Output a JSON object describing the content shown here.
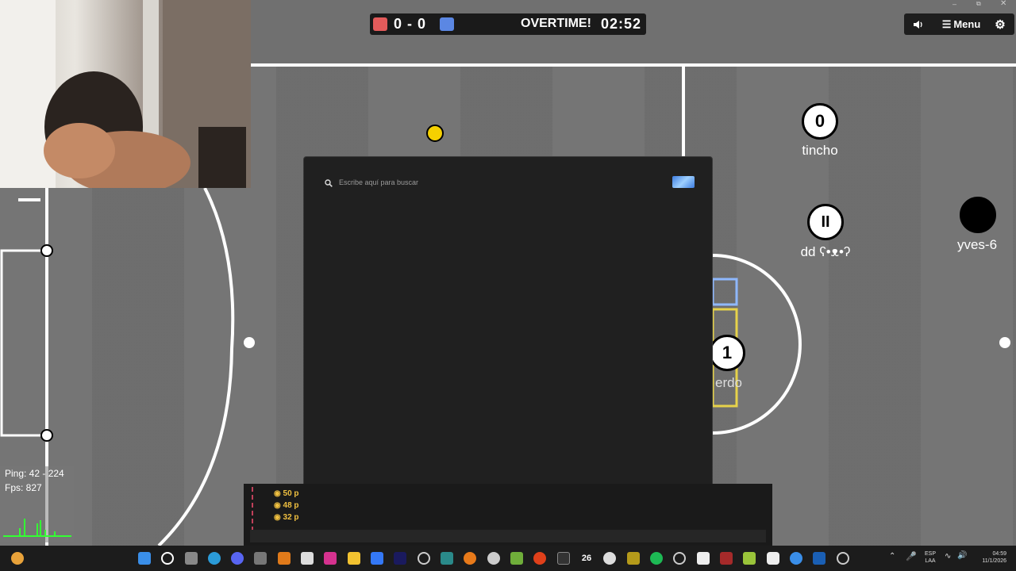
{
  "scoreboard": {
    "red_score": "0",
    "separator": "-",
    "blue_score": "0",
    "status": "OVERTIME!",
    "clock": "02:52",
    "red_color": "#e35b5b",
    "blue_color": "#5b87e3"
  },
  "topbar": {
    "sound_icon": "speaker-icon",
    "menu_label": "Menu",
    "settings_icon": "gear-icon"
  },
  "players": [
    {
      "label": "0",
      "name": "tincho"
    },
    {
      "label": "II",
      "name": "dd ʕ•ᴥ•ʔ"
    },
    {
      "label": "",
      "name": "yves-6"
    },
    {
      "label": "1",
      "name": "erdo"
    }
  ],
  "search": {
    "placeholder": "Escribe aquí para buscar"
  },
  "stats": {
    "ping": "Ping: 42 - 224",
    "fps": "Fps: 827"
  },
  "chat": {
    "items": [
      "50 p",
      "48 p",
      "32 p"
    ]
  },
  "taskbar": {
    "lang_1": "ESP",
    "lang_2": "LAA",
    "time": "04:59",
    "date": "11/1/2026",
    "calendar_badge": "26"
  }
}
